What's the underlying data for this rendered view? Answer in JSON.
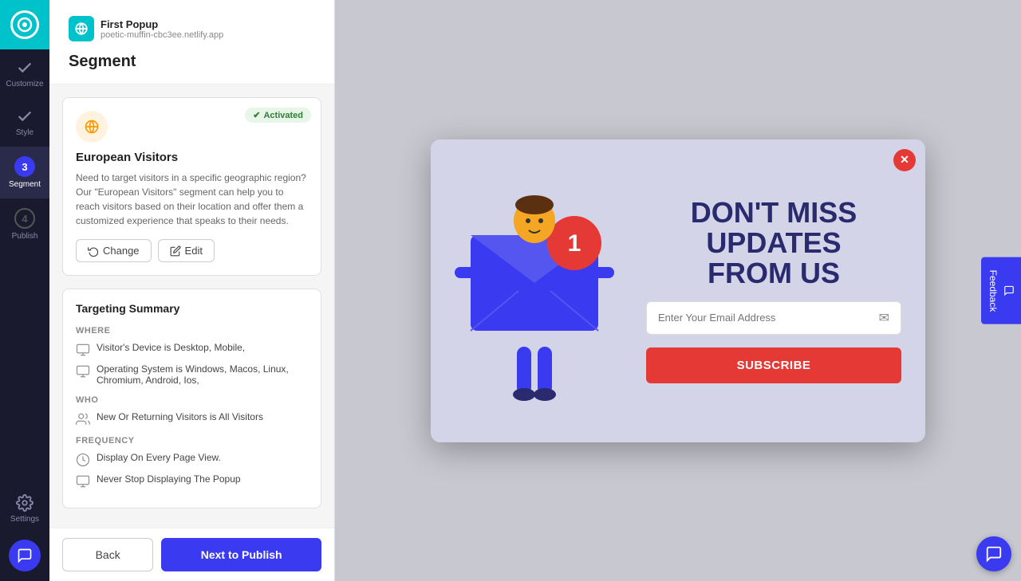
{
  "app": {
    "logo_label": "App Logo",
    "site_name": "First Popup",
    "site_url": "poetic-muffin-cbc3ee.netlify.app"
  },
  "left_nav": {
    "items": [
      {
        "id": "customize",
        "label": "Customize",
        "step": null,
        "active": false
      },
      {
        "id": "style",
        "label": "Style",
        "step": null,
        "active": false
      },
      {
        "id": "segment",
        "label": "Segment",
        "step": "3",
        "active": true
      },
      {
        "id": "publish",
        "label": "Publish",
        "step": "4",
        "active": false
      }
    ],
    "settings_label": "Settings",
    "feedback_label": "Feedback"
  },
  "panel": {
    "title": "Segment",
    "segment_card": {
      "badge_label": "Activated",
      "name": "European Visitors",
      "description": "Need to target visitors in a specific geographic region? Our \"European Visitors\" segment can help you to reach visitors based on their location and offer them a customized experience that speaks to their needs.",
      "change_label": "Change",
      "edit_label": "Edit"
    },
    "targeting_summary": {
      "title": "Targeting Summary",
      "where_label": "WHERE",
      "who_label": "WHO",
      "frequency_label": "FREQUENCY",
      "rows_where": [
        "Visitor's Device is Desktop, Mobile,",
        "Operating System is Windows, Macos, Linux, Chromium, Android, Ios,"
      ],
      "rows_who": [
        "New Or Returning Visitors is All Visitors"
      ],
      "rows_frequency": [
        "Display On Every Page View.",
        "Never Stop Displaying The Popup"
      ]
    }
  },
  "buttons": {
    "back_label": "Back",
    "next_label": "Next to Publish"
  },
  "popup": {
    "headline_line1": "DON'T MISS",
    "headline_line2": "UPDATES",
    "headline_line3": "FROM US",
    "email_placeholder": "Enter Your Email Address",
    "subscribe_label": "SUBSCRIBE",
    "close_icon": "✕"
  }
}
